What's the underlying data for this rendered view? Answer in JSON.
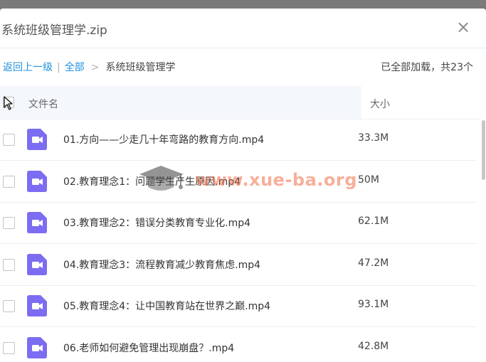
{
  "dialog": {
    "title": "系统班级管理学.zip",
    "close_label": "×"
  },
  "breadcrumb": {
    "back_label": "返回上一级",
    "divider": "|",
    "all_label": "全部",
    "arrow": ">",
    "current": "系统班级管理学"
  },
  "status": "已全部加载，共23个",
  "table": {
    "col_name": "文件名",
    "col_size": "大小",
    "rows": [
      {
        "name": "01.方向——少走几十年弯路的教育方向.mp4",
        "size": "33.3M"
      },
      {
        "name": "02.教育理念1：问题学生产生原因.mp4",
        "size": "50M"
      },
      {
        "name": "03.教育理念2：错误分类教育专业化.mp4",
        "size": "62.1M"
      },
      {
        "name": "04.教育理念3：流程教育减少教育焦虑.mp4",
        "size": "47.2M"
      },
      {
        "name": "05.教育理念4：让中国教育站在世界之巅.mp4",
        "size": "93.1M"
      },
      {
        "name": "06.老师如何避免管理出现崩盘？.mp4",
        "size": "42.8M"
      }
    ]
  },
  "watermark": "www.xue-ba.org",
  "colors": {
    "icon": "#7c6cf2",
    "link": "#1f8fdc",
    "header_bg": "#f4f8fd"
  },
  "icons": {
    "file": "video-file-icon",
    "close": "close-icon",
    "cursor": "mouse-pointer-icon"
  }
}
